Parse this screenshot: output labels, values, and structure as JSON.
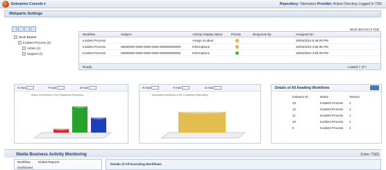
{
  "app": {
    "name": "Enterprise Console",
    "repository_label": "Repository:",
    "repository": "Telematics",
    "provider_label": "Provider:",
    "provider": "Active Directory",
    "logged_in_label": "Logged In",
    "user": "TSD"
  },
  "settings": {
    "title": "Webparts Settings"
  },
  "tree": {
    "items": [
      {
        "label": "Work Basket"
      },
      {
        "label": "Incident Process (2)"
      },
      {
        "label": "Admin (1)"
      },
      {
        "label": "Support (1)"
      }
    ]
  },
  "grid": {
    "headers": [
      "Workflow",
      "Subject",
      "Activity Display Name",
      "Priority",
      "Response By",
      "Assigned On"
    ],
    "top_right": "Work item list of TSD",
    "rows": [
      {
        "workflow": "Incident Process",
        "subject": "",
        "activity": "Assign Incident",
        "priority_color": "#f2b01e",
        "assigned": "10/04/2010 5:46:00 PM"
      },
      {
        "workflow": "Incident Process",
        "subject": "00000000-0000-0000-0000-000000000000",
        "activity": "Information2",
        "priority_color": "#f2b01e",
        "assigned": "10/04/2010 4:56:36 PM"
      },
      {
        "workflow": "Incident Process",
        "subject": "00000000-0000-0000-0000-000000000000",
        "activity": "Information1",
        "priority_color": "#4cae4c",
        "assigned": "10/04/2010 4:55:25 PM"
      }
    ],
    "status": "Ready.",
    "loaded": "Loaded 7 of 7"
  },
  "chart1": {
    "selectors": [
      "X-Axis",
      "Y-Axis",
      "Z-Axis"
    ],
    "title": "Status of Workflow in the Transaction Repository"
  },
  "chart2": {
    "selectors": [
      "X-Axis",
      "Y-Axis",
      "Z-Axis"
    ],
    "title": "Associated Workflows in the Transaction Repository"
  },
  "details": {
    "title": "Details of All Awaiting Workflows",
    "headers": [
      "Instance ID",
      "Name",
      "Version"
    ],
    "rows": [
      {
        "id": "13",
        "name": "Incident Process",
        "version": "1"
      },
      {
        "id": "12",
        "name": "Incident Process",
        "version": "1"
      },
      {
        "id": "11",
        "name": "Incident Process",
        "version": "1"
      },
      {
        "id": "10",
        "name": "Incident Process",
        "version": "1"
      },
      {
        "id": "9",
        "name": "Incident Process",
        "version": "1"
      }
    ]
  },
  "bam": {
    "title": "Skelta Business Activity Monitoring",
    "user": "(User: TSD)",
    "workflow_label": "Workflow",
    "workflow_value": "Global Reports",
    "dashboard": "Dashboard",
    "details_title": "Details of All Executing Workflows"
  },
  "chart_data": [
    {
      "type": "bar",
      "title": "Status of Workflow in the Transaction Repository",
      "categories": [
        "",
        "",
        ""
      ],
      "values": [
        1,
        7,
        4
      ],
      "colors": [
        "#d9242f",
        "#27a22a",
        "#1f3fb8"
      ]
    },
    {
      "type": "bar",
      "title": "Associated Workflows in the Transaction Repository",
      "categories": [
        ""
      ],
      "values": [
        7
      ],
      "colors": [
        "#e3bd4f"
      ]
    }
  ]
}
